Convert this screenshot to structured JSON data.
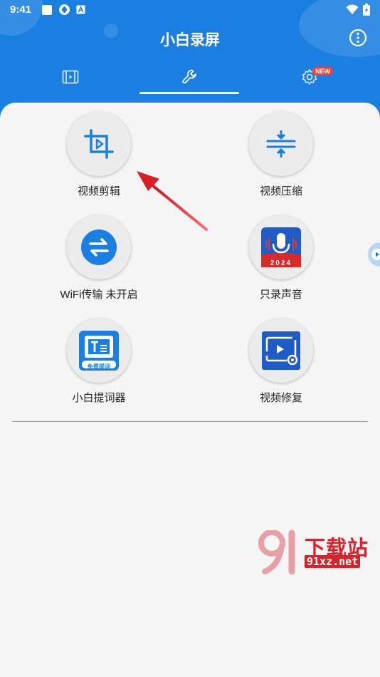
{
  "status_bar": {
    "time": "9:41"
  },
  "header": {
    "title": "小白录屏"
  },
  "tabs": {
    "new_badge": "NEW"
  },
  "tools": [
    {
      "label": "视频剪辑"
    },
    {
      "label": "视频压缩"
    },
    {
      "label": "WiFi传输 未开启"
    },
    {
      "label": "只录声音"
    },
    {
      "label": "小白提词器"
    },
    {
      "label": "视频修复"
    }
  ],
  "icon_text": {
    "record_year": "2024",
    "teleprompter": "免费提词"
  },
  "watermark": {
    "text": "下载站",
    "url": "91xz.net"
  },
  "colors": {
    "primary": "#1a7fe0",
    "background": "#f5f5f5",
    "arrow": "#d81f26",
    "badge": "#ff3b30"
  }
}
